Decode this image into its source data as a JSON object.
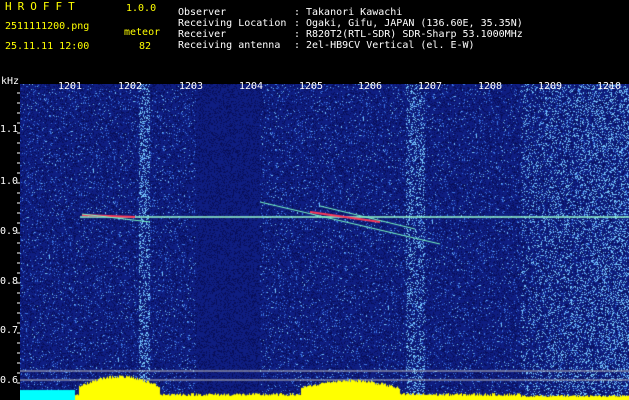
{
  "header": {
    "logo": "HROFFT",
    "version": "1.0.0",
    "filename": "2511111200.png",
    "datetime": "25.11.11 12:00",
    "mode_label": "meteor",
    "count": "82",
    "fields": [
      {
        "label": "Observer",
        "sep": ":",
        "value": "Takanori Kawachi"
      },
      {
        "label": "Receiving Location",
        "sep": ":",
        "value": "Ogaki, Gifu, JAPAN (136.60E, 35.35N)"
      },
      {
        "label": "Receiver",
        "sep": ":",
        "value": "R820T2(RTL-SDR) SDR-Sharp 53.1000MHz"
      },
      {
        "label": "Receiving antenna",
        "sep": ":",
        "value": "2el-HB9CV Vertical (el. E-W)"
      }
    ]
  },
  "axis": {
    "unit": "kHz",
    "time_ticks": [
      "1201",
      "1202",
      "1203",
      "1204",
      "1205",
      "1206",
      "1207",
      "1208",
      "1209",
      "1210"
    ],
    "freq_ticks": [
      "1.1",
      "1.0",
      "0.9",
      "0.8",
      "0.7",
      "0.6"
    ]
  },
  "colors": {
    "background": "#000000",
    "spectrogram_base": "#16248a",
    "carrier_line": "#9affd0",
    "meteor_trace": "#ff3a5a",
    "amplitude_fill": "#ffff00",
    "header_yellow": "#ffff00",
    "baseline_cyan": "#00ffff"
  }
}
